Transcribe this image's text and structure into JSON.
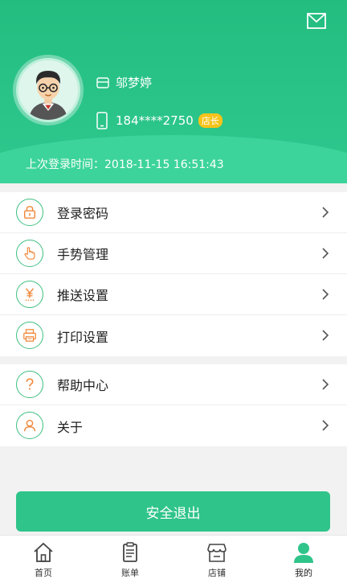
{
  "header": {
    "name": "邬梦婷",
    "phone": "184****2750",
    "role_badge": "店长",
    "last_login": "上次登录时间：2018-11-15 16:51:43"
  },
  "menu_group1": [
    {
      "label": "登录密码",
      "icon": "lock-icon"
    },
    {
      "label": "手势管理",
      "icon": "hand-gesture-icon"
    },
    {
      "label": "推送设置",
      "icon": "yen-push-icon"
    },
    {
      "label": "打印设置",
      "icon": "printer-icon"
    }
  ],
  "menu_group2": [
    {
      "label": "帮助中心",
      "icon": "question-icon"
    },
    {
      "label": "关于",
      "icon": "person-icon"
    }
  ],
  "logout_label": "安全退出",
  "tabs": [
    {
      "label": "首页",
      "icon": "home-icon"
    },
    {
      "label": "账单",
      "icon": "bill-icon"
    },
    {
      "label": "店铺",
      "icon": "shop-icon"
    },
    {
      "label": "我的",
      "icon": "profile-icon",
      "active": true
    }
  ],
  "colors": {
    "primary": "#2fc48a",
    "accent": "#f0873a",
    "badge": "#f5c31b"
  }
}
